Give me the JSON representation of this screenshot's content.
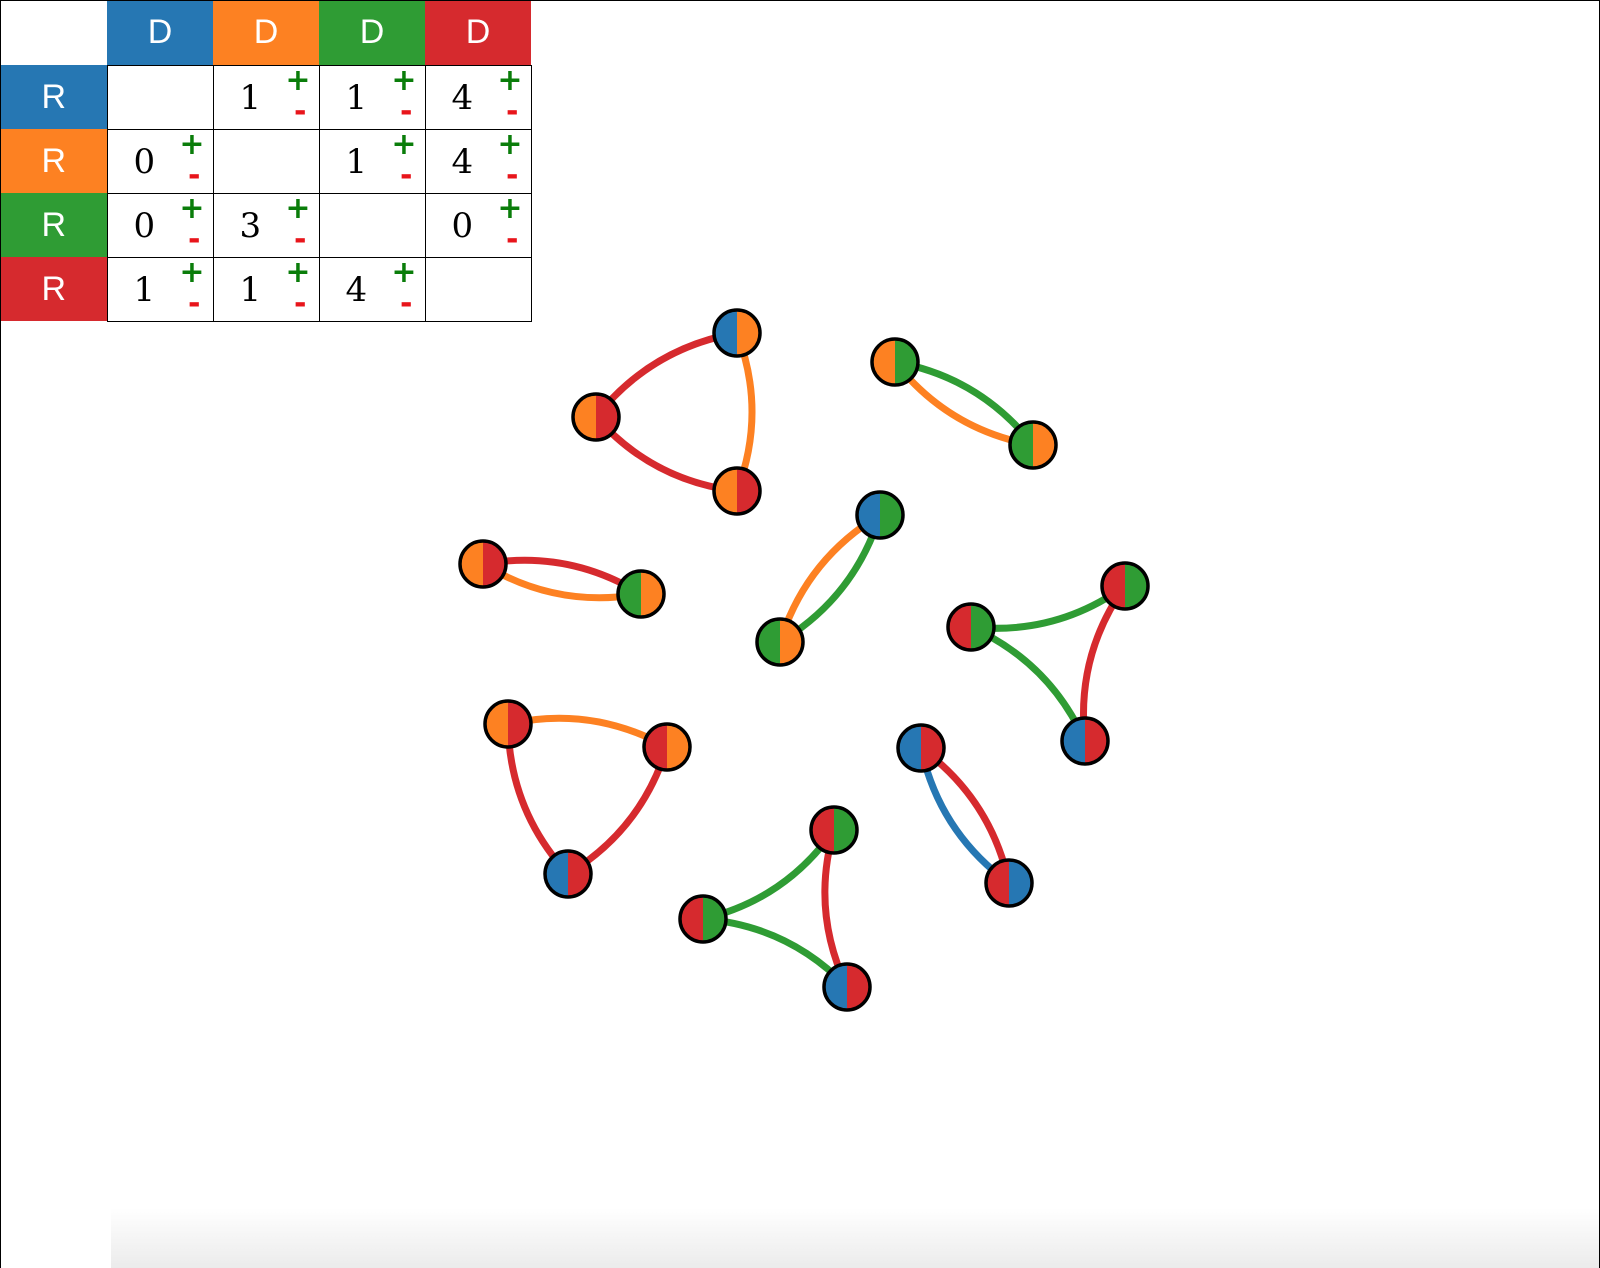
{
  "colors": {
    "blue": "#2677b3",
    "orange": "#fd8122",
    "green": "#2f9c34",
    "red": "#d62a2e",
    "plus": "#0a7d0a",
    "minus": "#e8151b"
  },
  "matrix": {
    "column_headers": [
      {
        "label": "D",
        "color": "blue"
      },
      {
        "label": "D",
        "color": "orange"
      },
      {
        "label": "D",
        "color": "green"
      },
      {
        "label": "D",
        "color": "red"
      }
    ],
    "row_headers": [
      {
        "label": "R",
        "color": "blue"
      },
      {
        "label": "R",
        "color": "orange"
      },
      {
        "label": "R",
        "color": "green"
      },
      {
        "label": "R",
        "color": "red"
      }
    ],
    "plus_label": "+",
    "minus_label": "-",
    "values": [
      [
        null,
        "1",
        "1",
        "4"
      ],
      [
        "0",
        null,
        "1",
        "4"
      ],
      [
        "0",
        "3",
        null,
        "0"
      ],
      [
        "1",
        "1",
        "4",
        null
      ]
    ]
  },
  "graph": {
    "nodes": [
      {
        "id": "a1",
        "left": "blue",
        "right": "orange"
      },
      {
        "id": "a2",
        "left": "orange",
        "right": "red"
      },
      {
        "id": "a3",
        "left": "orange",
        "right": "red"
      },
      {
        "id": "b1",
        "left": "orange",
        "right": "green"
      },
      {
        "id": "b2",
        "left": "green",
        "right": "orange"
      },
      {
        "id": "c1",
        "left": "orange",
        "right": "red"
      },
      {
        "id": "c2",
        "left": "red",
        "right": "orange"
      },
      {
        "id": "c3",
        "left": "blue",
        "right": "red"
      },
      {
        "id": "d1",
        "left": "orange",
        "right": "red"
      },
      {
        "id": "d2",
        "left": "green",
        "right": "orange"
      },
      {
        "id": "e1",
        "left": "blue",
        "right": "green"
      },
      {
        "id": "e2",
        "left": "green",
        "right": "orange"
      },
      {
        "id": "f1",
        "left": "red",
        "right": "green"
      },
      {
        "id": "f2",
        "left": "red",
        "right": "green"
      },
      {
        "id": "f3",
        "left": "blue",
        "right": "red"
      },
      {
        "id": "g1",
        "left": "blue",
        "right": "red"
      },
      {
        "id": "g2",
        "left": "red",
        "right": "blue"
      },
      {
        "id": "h1",
        "left": "red",
        "right": "green"
      },
      {
        "id": "h2",
        "left": "red",
        "right": "green"
      },
      {
        "id": "h3",
        "left": "blue",
        "right": "red"
      }
    ],
    "edges": [
      {
        "from": "a2",
        "to": "a1",
        "color": "red"
      },
      {
        "from": "a1",
        "to": "a3",
        "color": "orange"
      },
      {
        "from": "a3",
        "to": "a2",
        "color": "red"
      },
      {
        "from": "b1",
        "to": "b2",
        "color": "green"
      },
      {
        "from": "b2",
        "to": "b1",
        "color": "orange"
      },
      {
        "from": "c1",
        "to": "c2",
        "color": "orange"
      },
      {
        "from": "c2",
        "to": "c3",
        "color": "red"
      },
      {
        "from": "c3",
        "to": "c1",
        "color": "red"
      },
      {
        "from": "d1",
        "to": "d2",
        "color": "red"
      },
      {
        "from": "d2",
        "to": "d1",
        "color": "orange"
      },
      {
        "from": "e1",
        "to": "e2",
        "color": "green"
      },
      {
        "from": "e2",
        "to": "e1",
        "color": "orange"
      },
      {
        "from": "f1",
        "to": "f2",
        "color": "green"
      },
      {
        "from": "f2",
        "to": "f3",
        "color": "green"
      },
      {
        "from": "f3",
        "to": "f1",
        "color": "red"
      },
      {
        "from": "g1",
        "to": "g2",
        "color": "red"
      },
      {
        "from": "g2",
        "to": "g1",
        "color": "blue"
      },
      {
        "from": "h1",
        "to": "h2",
        "color": "green"
      },
      {
        "from": "h2",
        "to": "h3",
        "color": "green"
      },
      {
        "from": "h3",
        "to": "h1",
        "color": "red"
      }
    ]
  }
}
